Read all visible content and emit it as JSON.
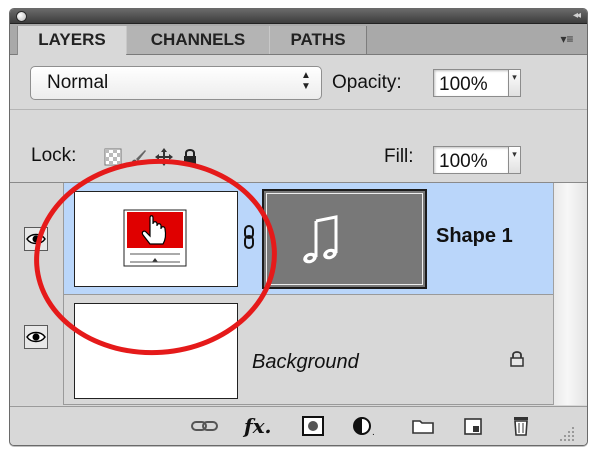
{
  "tabs": [
    {
      "label": "LAYERS",
      "active": true
    },
    {
      "label": "CHANNELS",
      "active": false
    },
    {
      "label": "PATHS",
      "active": false
    }
  ],
  "blend_mode": {
    "value": "Normal"
  },
  "opacity": {
    "label": "Opacity:",
    "value": "100%"
  },
  "lock": {
    "label": "Lock:"
  },
  "fill": {
    "label": "Fill:",
    "value": "100%"
  },
  "layers": [
    {
      "name": "Shape 1",
      "selected": true,
      "visible": true,
      "thumbnail": "red-button-with-hand-cursor",
      "mask": "music-note-shape"
    },
    {
      "name": "Background",
      "selected": false,
      "visible": true,
      "locked": true
    }
  ],
  "colors": {
    "selected_row": "#bad6fa",
    "annotation_circle": "#e51a1a",
    "thumbnail_red": "#e00000",
    "mask_gray": "#787878"
  },
  "bottom_icons": [
    "link-icon",
    "fx-icon",
    "layer-mask-icon",
    "adjustment-layer-icon",
    "group-folder-icon",
    "new-layer-icon",
    "trash-icon"
  ]
}
